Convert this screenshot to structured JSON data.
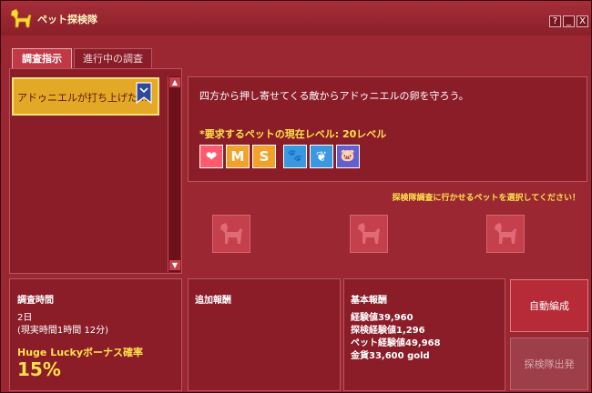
{
  "window": {
    "title": "ペット探検隊",
    "buttons": {
      "help": "?",
      "minimize": "_",
      "close": "X"
    }
  },
  "tabs": [
    {
      "label": "調査指示",
      "active": true
    },
    {
      "label": "進行中の調査",
      "active": false
    }
  ],
  "mission_list": {
    "items": [
      {
        "label": "アドゥニエルが打ち上げた…",
        "selected": true
      }
    ],
    "scroll_up": "▲",
    "scroll_down": "▼"
  },
  "mission_detail": {
    "description": "四方から押し寄せてくる敵からアドゥニエルの卵を守ろう。",
    "required_level": "*要求するペットの現在レベル: 20レベル",
    "pet_types": [
      {
        "icon": "heart-icon",
        "glyph": "❤",
        "color": "#ff5a6e"
      },
      {
        "icon": "m-letter-icon",
        "glyph": "M",
        "color": "#f2a22a"
      },
      {
        "icon": "s-letter-icon",
        "glyph": "S",
        "color": "#f2a22a"
      },
      {
        "icon": "paw-icon",
        "glyph": "🐾",
        "color": "#3a98e0"
      },
      {
        "icon": "wing-icon",
        "glyph": "❦",
        "color": "#3a98e0"
      },
      {
        "icon": "pig-icon",
        "glyph": "🐷",
        "color": "#6060d0"
      }
    ],
    "instruction": "探検隊調査に行かせるペットを選択してください！",
    "pet_slots": 3
  },
  "investigation": {
    "label": "調査時間",
    "duration": "2日",
    "real_time": "(現実時間1時間 12分)",
    "bonus_label": "Huge Luckyボーナス確率",
    "bonus_value": "15%"
  },
  "extra_reward": {
    "label": "追加報酬"
  },
  "base_reward": {
    "label": "基本報酬",
    "lines": [
      "経験値39,960",
      "探検経験値1,296",
      "ペット経験値49,968",
      "金貨33,600 gold"
    ]
  },
  "actions": {
    "auto_button": "自動編成",
    "depart_button": "探検隊出発"
  },
  "colors": {
    "accent": "#ffe14a",
    "selected_item": "#e3a826",
    "window_bg": "#9a2732",
    "panel_bg": "#8b1d28"
  }
}
